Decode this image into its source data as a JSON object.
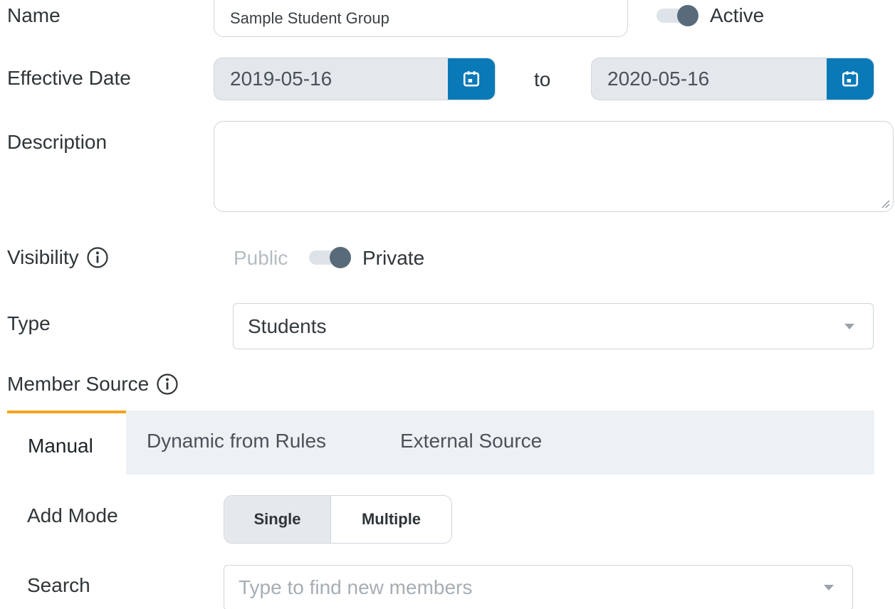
{
  "form": {
    "name": {
      "label": "Name",
      "value": "Sample Student Group"
    },
    "active": {
      "label": "Active",
      "on": true
    },
    "effective_date": {
      "label": "Effective Date",
      "start": "2019-05-16",
      "separator": "to",
      "end": "2020-05-16"
    },
    "description": {
      "label": "Description",
      "value": ""
    },
    "visibility": {
      "label": "Visibility",
      "off_label": "Public",
      "on_label": "Private",
      "selected": "Private"
    },
    "type": {
      "label": "Type",
      "value": "Students"
    },
    "member_source": {
      "label": "Member Source",
      "tabs": [
        {
          "label": "Manual",
          "active": true
        },
        {
          "label": "Dynamic from Rules",
          "active": false
        },
        {
          "label": "External Source",
          "active": false
        }
      ]
    },
    "add_mode": {
      "label": "Add Mode",
      "options": [
        "Single",
        "Multiple"
      ],
      "selected": "Single"
    },
    "search": {
      "label": "Search",
      "placeholder": "Type to find new members"
    }
  },
  "colors": {
    "accent_blue": "#0a79b8",
    "tab_indicator": "#f5a31a",
    "toggle_knob": "#596b7a"
  },
  "icons": {
    "calendar": "calendar-icon",
    "info": "info-icon",
    "dropdown": "chevron-down-icon"
  }
}
